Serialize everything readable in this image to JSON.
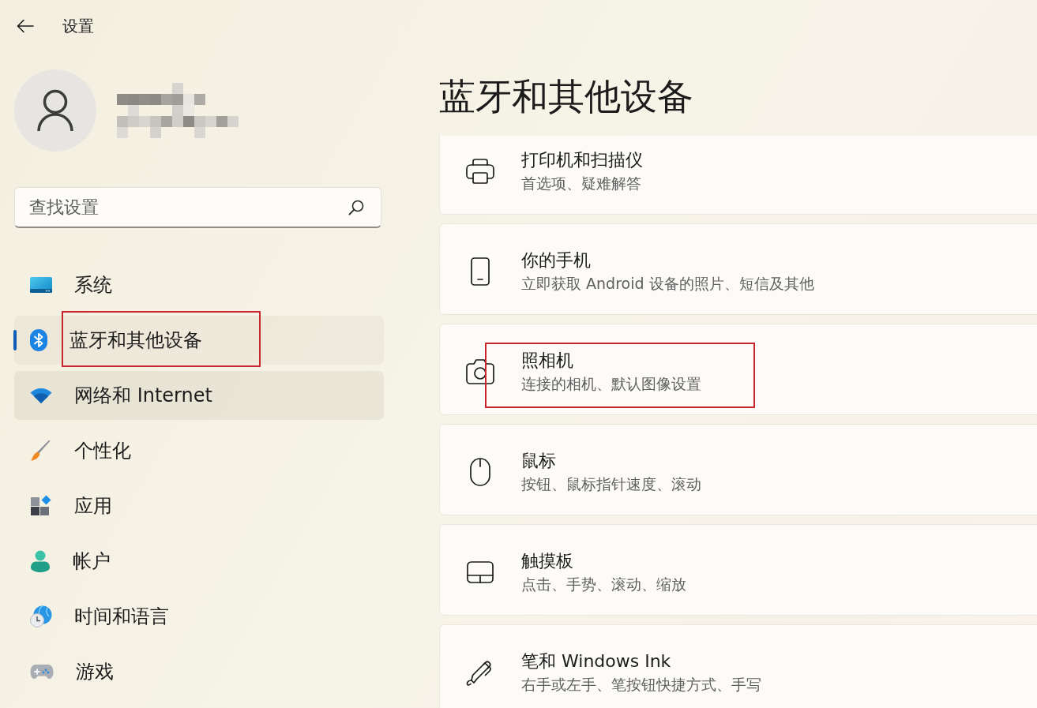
{
  "window": {
    "title": "设置"
  },
  "search": {
    "placeholder": "查找设置"
  },
  "sidebar": {
    "items": [
      {
        "label": "系统",
        "selected": false,
        "hovered": false,
        "highlighted": false
      },
      {
        "label": "蓝牙和其他设备",
        "selected": true,
        "hovered": false,
        "highlighted": true
      },
      {
        "label": "网络和 Internet",
        "selected": false,
        "hovered": true,
        "highlighted": false
      },
      {
        "label": "个性化",
        "selected": false,
        "hovered": false,
        "highlighted": false
      },
      {
        "label": "应用",
        "selected": false,
        "hovered": false,
        "highlighted": false
      },
      {
        "label": "帐户",
        "selected": false,
        "hovered": false,
        "highlighted": false
      },
      {
        "label": "时间和语言",
        "selected": false,
        "hovered": false,
        "highlighted": false
      },
      {
        "label": "游戏",
        "selected": false,
        "hovered": false,
        "highlighted": false
      }
    ]
  },
  "page": {
    "title": "蓝牙和其他设备",
    "cards": [
      {
        "title": "打印机和扫描仪",
        "subtitle": "首选项、疑难解答",
        "highlighted": false
      },
      {
        "title": "你的手机",
        "subtitle": "立即获取 Android 设备的照片、短信及其他",
        "highlighted": false
      },
      {
        "title": "照相机",
        "subtitle": "连接的相机、默认图像设置",
        "highlighted": true
      },
      {
        "title": "鼠标",
        "subtitle": "按钮、鼠标指针速度、滚动",
        "highlighted": false
      },
      {
        "title": "触摸板",
        "subtitle": "点击、手势、滚动、缩放",
        "highlighted": false
      },
      {
        "title": "笔和 Windows Ink",
        "subtitle": "右手或左手、笔按钮快捷方式、手写",
        "highlighted": false
      }
    ]
  }
}
